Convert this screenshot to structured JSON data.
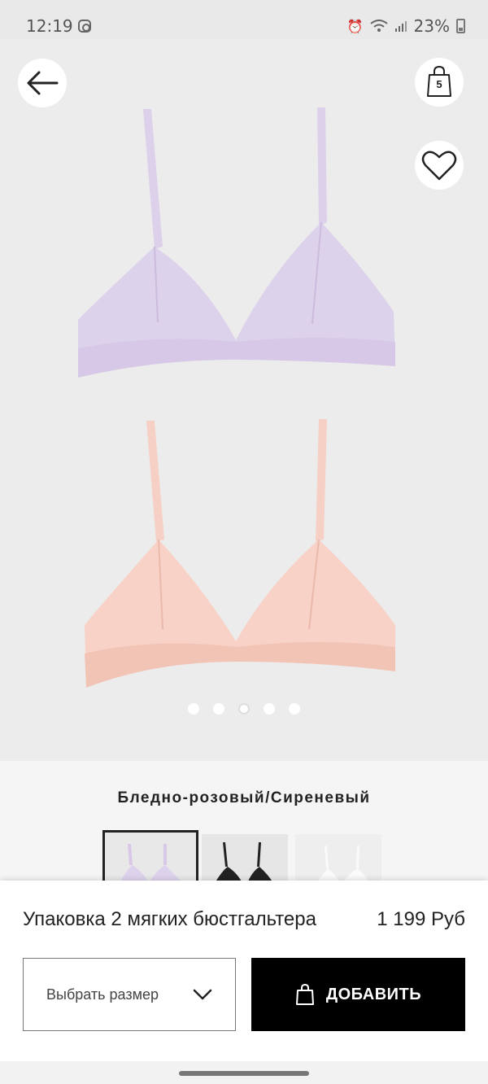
{
  "status_bar": {
    "time": "12:19",
    "battery": "23%",
    "icons": [
      "instagram-icon",
      "alarm-icon",
      "wifi-icon",
      "signal-icon",
      "battery-icon"
    ]
  },
  "header": {
    "back_icon": "arrow-left-icon",
    "bag_count": "5",
    "bag_icon": "shopping-bag-icon",
    "favorite_icon": "heart-icon"
  },
  "gallery": {
    "dot_count": 5,
    "active_dot": 3
  },
  "product": {
    "color_name": "Бледно-розовый/Сиреневый",
    "title": "Упаковка 2 мягких бюстгальтера",
    "price": "1 199 Руб",
    "colors": [
      "#d9c7e8",
      "#f4c9bd"
    ],
    "swatches": [
      "lilac-pink",
      "black",
      "white"
    ]
  },
  "actions": {
    "size_placeholder": "Выбрать размер",
    "add_label": "ДОБАВИТЬ"
  }
}
